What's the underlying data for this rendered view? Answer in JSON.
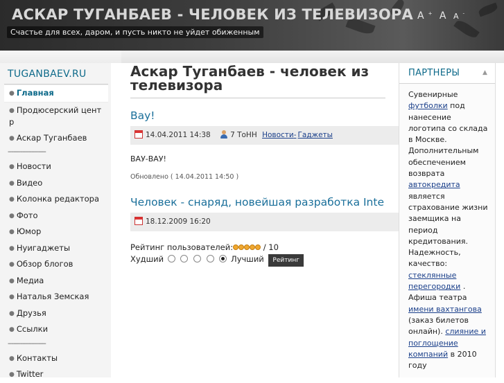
{
  "header": {
    "title": "АСКАР ТУГАНБАЕВ - ЧЕЛОВЕК ИЗ ТЕЛЕВИЗОРА",
    "slogan": "Счастье для всех, даром, и пусть никто не уйдет обиженным",
    "font_tools": [
      "A",
      "A",
      "A"
    ]
  },
  "sidebar": {
    "title": "TUGANBAEV.RU",
    "items": [
      {
        "label": "Главная",
        "active": true
      },
      {
        "label": "Продюсерский цент р"
      },
      {
        "label": "Аскар Туганбаев"
      },
      {
        "separator": "---------------------"
      },
      {
        "label": "Новости"
      },
      {
        "label": "Видео"
      },
      {
        "label": "Колонка редактора"
      },
      {
        "label": "Фото"
      },
      {
        "label": "Юмор"
      },
      {
        "label": "Нуигаджеты"
      },
      {
        "label": "Обзор блогов"
      },
      {
        "label": "Медиа"
      },
      {
        "label": "Наталья Земская"
      },
      {
        "label": "Друзья"
      },
      {
        "label": "Ссылки"
      },
      {
        "separator": "---------------------"
      },
      {
        "label": "Контакты"
      },
      {
        "label": "Twitter"
      }
    ]
  },
  "main": {
    "page_title": "Аскар Туганбаев - человек из телевизора",
    "articles": [
      {
        "title": "Вау!",
        "date": "14.04.2011 14:38",
        "author": "7 ТоНН",
        "category": "Новости",
        "category_sep": "-",
        "subcategory": "Гаджеты",
        "body": "ВАУ-ВАУ!",
        "updated": "Обновлено ( 14.04.2011 14:50 )"
      },
      {
        "title": "Человек - снаряд, новейшая разработка Inte",
        "date": "18.12.2009 16:20"
      }
    ],
    "rating": {
      "label": "Рейтинг пользователей:",
      "value": 0,
      "max": "/ 10",
      "worst": "Худший",
      "best": "Лучший",
      "button": "Рейтинг",
      "selected_index": 3
    }
  },
  "right": {
    "title": "ПАРТНЕРЫ",
    "text1": "Сувенирные",
    "link1": "футболки",
    "text2": "под нанесение логотипа со склада в Москве. Дополнительным обеспечением возврата",
    "link2": "автокредита",
    "text3": "является страхование жизни заемщика на период кредитования. Надежность, качество:",
    "link3": "стеклянные перегородки",
    "text4": ". Афиша театра",
    "link4": "имени вахтангова",
    "text5": "(заказ билетов онлайн).",
    "link5": "слияние и поглощение компаний",
    "text6": "в 2010 году"
  }
}
